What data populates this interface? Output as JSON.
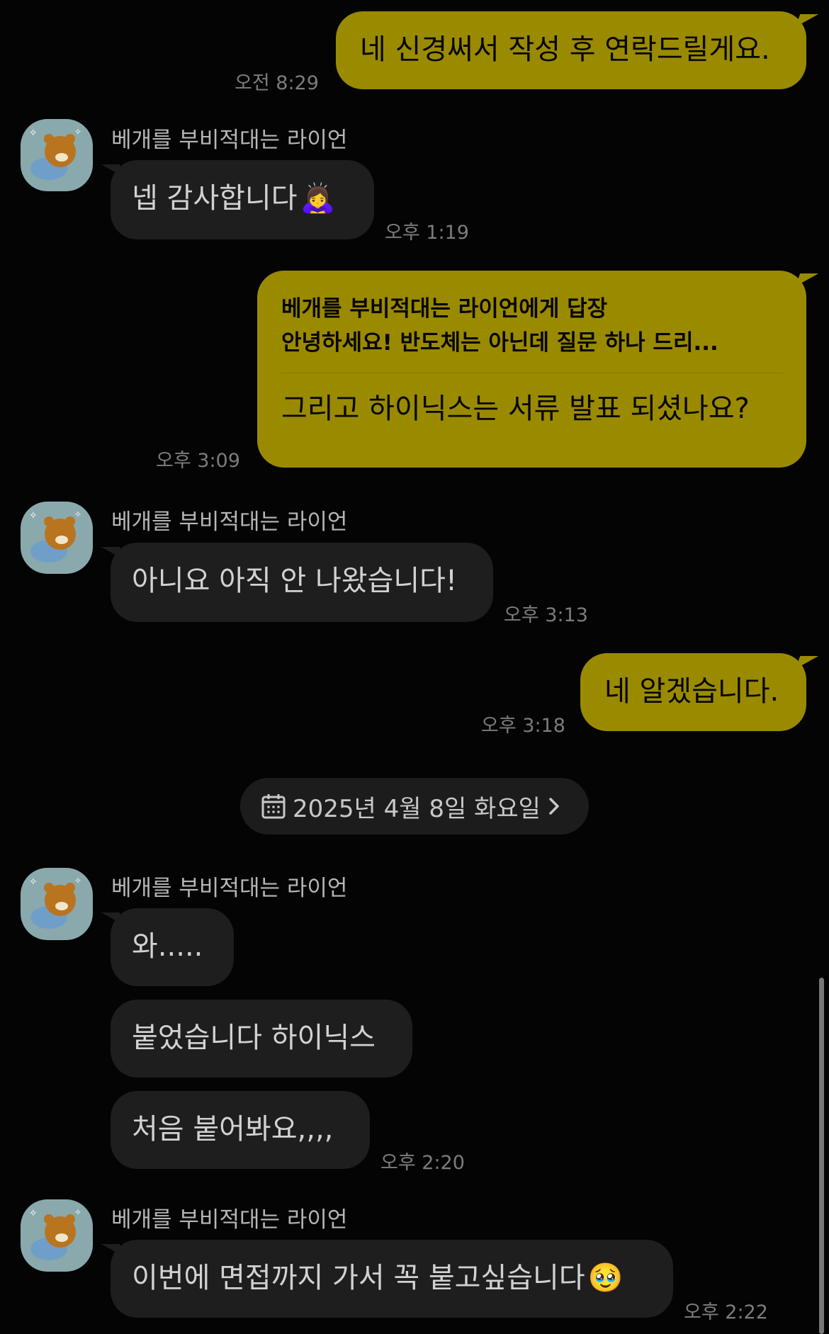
{
  "colors": {
    "background": "#040404",
    "outgoing_bubble": "#9a8a00",
    "incoming_bubble": "#1e1e1e",
    "time_text": "#7c7c7c"
  },
  "messages": {
    "m1": {
      "text": "네 신경써서 작성 후 연락드릴게요.",
      "time": "오전 8:29"
    },
    "m2": {
      "sender": "베개를 부비적대는 라이언",
      "text": "넵 감사합니다",
      "emoji": "🙇‍♀️",
      "time": "오후 1:19"
    },
    "m3": {
      "reply_to": "베개를 부비적대는 라이언에게 답장",
      "quote": "안녕하세요! 반도체는 아닌데 질문 하나 드리...",
      "text": "그리고 하이닉스는 서류 발표 되셨나요?",
      "time": "오후 3:09"
    },
    "m4": {
      "sender": "베개를 부비적대는 라이언",
      "text": "아니요 아직 안 나왔습니다!",
      "time": "오후 3:13"
    },
    "m5": {
      "text": "네 알겠습니다.",
      "time": "오후 3:18"
    },
    "date_divider": {
      "icon": "calendar-icon",
      "label": "2025년 4월 8일 화요일",
      "chevron": "chevron-right-icon"
    },
    "m6": {
      "sender": "베개를 부비적대는 라이언",
      "text1": "와.....",
      "text2": "붙었습니다 하이닉스",
      "text3": "처음 붙어봐요,,,,",
      "time": "오후 2:20"
    },
    "m7": {
      "sender": "베개를 부비적대는 라이언",
      "text": "이번에 면접까지 가서 꼭 붙고싶습니다",
      "emoji": "🥹",
      "time": "오후 2:22"
    }
  }
}
